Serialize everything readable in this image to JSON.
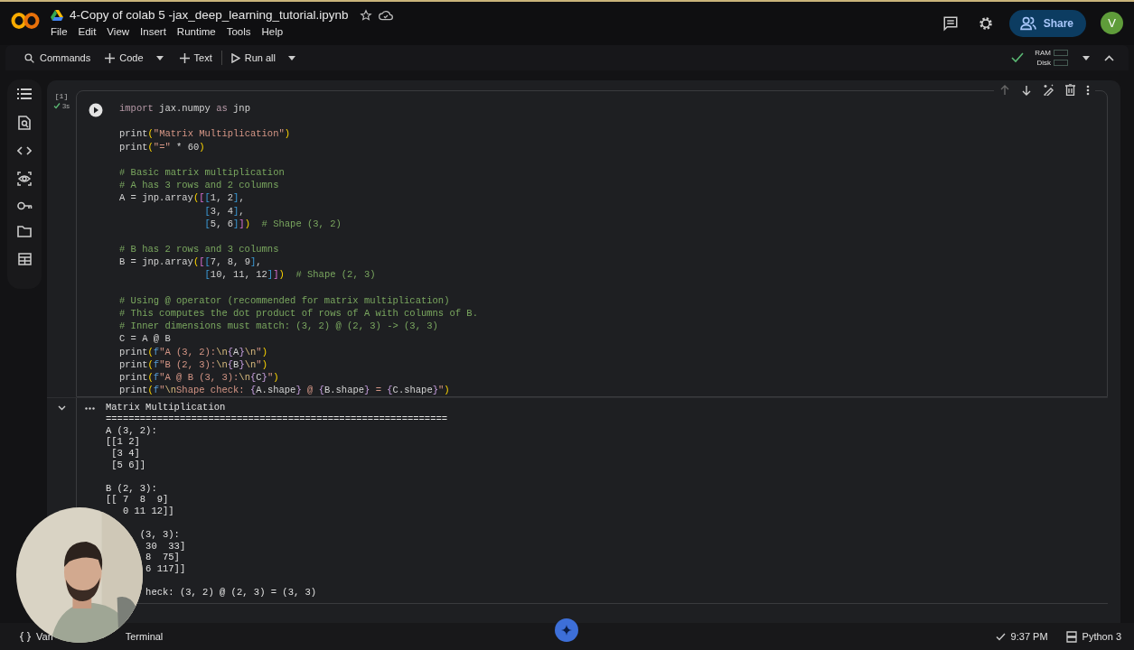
{
  "header": {
    "title": "4-Copy of colab 5 -jax_deep_learning_tutorial.ipynb",
    "menu": [
      "File",
      "Edit",
      "View",
      "Insert",
      "Runtime",
      "Tools",
      "Help"
    ]
  },
  "account": {
    "share": "Share",
    "avatar": "V"
  },
  "toolbar": {
    "commands": "Commands",
    "add_code": "Code",
    "add_text": "Text",
    "run_all": "Run all"
  },
  "resources": {
    "connected": true,
    "ram": "RAM",
    "disk": "Disk"
  },
  "cell": {
    "execution_count": "[1]",
    "succeeded": true,
    "duration": "3s",
    "code": [
      {
        "kind": "code",
        "tokens": [
          {
            "kind": "kw",
            "text": "import"
          },
          {
            "kind": "plain",
            "text": " jax.numpy "
          },
          {
            "kind": "kw",
            "text": "as"
          },
          {
            "kind": "plain",
            "text": " jnp"
          }
        ]
      },
      {
        "kind": "blank"
      },
      {
        "kind": "code",
        "tokens": [
          {
            "kind": "plain",
            "text": "print"
          },
          {
            "kind": "br1",
            "text": "("
          },
          {
            "kind": "str",
            "text": "\"Matrix Multiplication\""
          },
          {
            "kind": "br1",
            "text": ")"
          }
        ]
      },
      {
        "kind": "code",
        "tokens": [
          {
            "kind": "plain",
            "text": "print"
          },
          {
            "kind": "br1",
            "text": "("
          },
          {
            "kind": "str",
            "text": "\"=\""
          },
          {
            "kind": "plain",
            "text": " * 60"
          },
          {
            "kind": "br1",
            "text": ")"
          }
        ]
      },
      {
        "kind": "blank"
      },
      {
        "kind": "code",
        "tokens": [
          {
            "kind": "com",
            "text": "# Basic matrix multiplication"
          }
        ]
      },
      {
        "kind": "code",
        "tokens": [
          {
            "kind": "com",
            "text": "# A has 3 rows and 2 columns"
          }
        ]
      },
      {
        "kind": "code",
        "tokens": [
          {
            "kind": "plain",
            "text": "A = jnp.array"
          },
          {
            "kind": "br1",
            "text": "("
          },
          {
            "kind": "br2",
            "text": "["
          },
          {
            "kind": "br3",
            "text": "["
          },
          {
            "kind": "plain",
            "text": "1, 2"
          },
          {
            "kind": "br3",
            "text": "]"
          },
          {
            "kind": "plain",
            "text": ","
          }
        ]
      },
      {
        "kind": "code",
        "tokens": [
          {
            "kind": "br3",
            "text": "               ["
          },
          {
            "kind": "plain",
            "text": "3, 4"
          },
          {
            "kind": "br3",
            "text": "]"
          },
          {
            "kind": "plain",
            "text": ","
          }
        ]
      },
      {
        "kind": "code",
        "tokens": [
          {
            "kind": "br3",
            "text": "               ["
          },
          {
            "kind": "plain",
            "text": "5, 6"
          },
          {
            "kind": "br3",
            "text": "]"
          },
          {
            "kind": "br2",
            "text": "]"
          },
          {
            "kind": "br1",
            "text": ")"
          },
          {
            "kind": "com",
            "text": "  # Shape (3, 2)"
          }
        ]
      },
      {
        "kind": "blank"
      },
      {
        "kind": "code",
        "tokens": [
          {
            "kind": "com",
            "text": "# B has 2 rows and 3 columns"
          }
        ]
      },
      {
        "kind": "code",
        "tokens": [
          {
            "kind": "plain",
            "text": "B = jnp.array"
          },
          {
            "kind": "br1",
            "text": "("
          },
          {
            "kind": "br2",
            "text": "["
          },
          {
            "kind": "br3",
            "text": "["
          },
          {
            "kind": "plain",
            "text": "7, 8, 9"
          },
          {
            "kind": "br3",
            "text": "]"
          },
          {
            "kind": "plain",
            "text": ","
          }
        ]
      },
      {
        "kind": "code",
        "tokens": [
          {
            "kind": "br3",
            "text": "               ["
          },
          {
            "kind": "plain",
            "text": "10, 11, 12"
          },
          {
            "kind": "br3",
            "text": "]"
          },
          {
            "kind": "br2",
            "text": "]"
          },
          {
            "kind": "br1",
            "text": ")"
          },
          {
            "kind": "com",
            "text": "  # Shape (2, 3)"
          }
        ]
      },
      {
        "kind": "blank"
      },
      {
        "kind": "code",
        "tokens": [
          {
            "kind": "com",
            "text": "# Using @ operator (recommended for matrix multiplication)"
          }
        ]
      },
      {
        "kind": "code",
        "tokens": [
          {
            "kind": "com",
            "text": "# This computes the dot product of rows of A with columns of B."
          }
        ]
      },
      {
        "kind": "code",
        "tokens": [
          {
            "kind": "com",
            "text": "# Inner dimensions must match: (3, 2) @ (2, 3) -> (3, 3)"
          }
        ]
      },
      {
        "kind": "code",
        "tokens": [
          {
            "kind": "plain",
            "text": "C = A @ B"
          }
        ]
      },
      {
        "kind": "code",
        "tokens": [
          {
            "kind": "plain",
            "text": "print"
          },
          {
            "kind": "br1",
            "text": "("
          },
          {
            "kind": "fpre",
            "text": "f"
          },
          {
            "kind": "str",
            "text": "\"A (3, 2):"
          },
          {
            "kind": "esc",
            "text": "\\n"
          },
          {
            "kind": "brace",
            "text": "{"
          },
          {
            "kind": "plain",
            "text": "A"
          },
          {
            "kind": "brace",
            "text": "}"
          },
          {
            "kind": "esc",
            "text": "\\n"
          },
          {
            "kind": "str",
            "text": "\""
          },
          {
            "kind": "br1",
            "text": ")"
          }
        ]
      },
      {
        "kind": "code",
        "tokens": [
          {
            "kind": "plain",
            "text": "print"
          },
          {
            "kind": "br1",
            "text": "("
          },
          {
            "kind": "fpre",
            "text": "f"
          },
          {
            "kind": "str",
            "text": "\"B (2, 3):"
          },
          {
            "kind": "esc",
            "text": "\\n"
          },
          {
            "kind": "brace",
            "text": "{"
          },
          {
            "kind": "plain",
            "text": "B"
          },
          {
            "kind": "brace",
            "text": "}"
          },
          {
            "kind": "esc",
            "text": "\\n"
          },
          {
            "kind": "str",
            "text": "\""
          },
          {
            "kind": "br1",
            "text": ")"
          }
        ]
      },
      {
        "kind": "code",
        "tokens": [
          {
            "kind": "plain",
            "text": "print"
          },
          {
            "kind": "br1",
            "text": "("
          },
          {
            "kind": "fpre",
            "text": "f"
          },
          {
            "kind": "str",
            "text": "\"A @ B (3, 3):"
          },
          {
            "kind": "esc",
            "text": "\\n"
          },
          {
            "kind": "brace",
            "text": "{"
          },
          {
            "kind": "plain",
            "text": "C"
          },
          {
            "kind": "brace",
            "text": "}"
          },
          {
            "kind": "str",
            "text": "\""
          },
          {
            "kind": "br1",
            "text": ")"
          }
        ]
      },
      {
        "kind": "code",
        "tokens": [
          {
            "kind": "plain",
            "text": "print"
          },
          {
            "kind": "br1",
            "text": "("
          },
          {
            "kind": "fpre",
            "text": "f"
          },
          {
            "kind": "str",
            "text": "\""
          },
          {
            "kind": "esc",
            "text": "\\n"
          },
          {
            "kind": "str",
            "text": "Shape check: "
          },
          {
            "kind": "brace",
            "text": "{"
          },
          {
            "kind": "plain",
            "text": "A.shape"
          },
          {
            "kind": "brace",
            "text": "}"
          },
          {
            "kind": "str",
            "text": " @ "
          },
          {
            "kind": "brace",
            "text": "{"
          },
          {
            "kind": "plain",
            "text": "B.shape"
          },
          {
            "kind": "brace",
            "text": "}"
          },
          {
            "kind": "str",
            "text": " = "
          },
          {
            "kind": "brace",
            "text": "{"
          },
          {
            "kind": "plain",
            "text": "C.shape"
          },
          {
            "kind": "brace",
            "text": "}"
          },
          {
            "kind": "str",
            "text": "\""
          },
          {
            "kind": "br1",
            "text": ")"
          }
        ]
      }
    ],
    "output": {
      "expanded": true,
      "lines": [
        {
          "kind": "text",
          "text": "Matrix Multiplication"
        },
        {
          "kind": "text",
          "text": "============================================================"
        },
        {
          "kind": "text",
          "text": "A (3, 2):"
        },
        {
          "kind": "text",
          "text": "[[1 2]"
        },
        {
          "kind": "text",
          "text": " [3 4]"
        },
        {
          "kind": "text",
          "text": " [5 6]]"
        },
        {
          "kind": "blank"
        },
        {
          "kind": "text",
          "text": "B (2, 3):"
        },
        {
          "kind": "text",
          "text": "[[ 7  8  9]"
        },
        {
          "kind": "text",
          "text": "   0 11 12]]"
        },
        {
          "kind": "blank"
        },
        {
          "kind": "text",
          "text": "      (3, 3):"
        },
        {
          "kind": "text",
          "text": "       30  33]"
        },
        {
          "kind": "text",
          "text": "       8  75]"
        },
        {
          "kind": "text",
          "text": "       6 117]]"
        },
        {
          "kind": "blank"
        },
        {
          "kind": "text",
          "text": "       heck: (3, 2) @ (2, 3) = (3, 3)"
        }
      ]
    }
  },
  "status_bar": {
    "variables": "Vari",
    "terminal": "Terminal",
    "saved": true,
    "time": "9:37 PM",
    "runtime": "Python 3"
  }
}
